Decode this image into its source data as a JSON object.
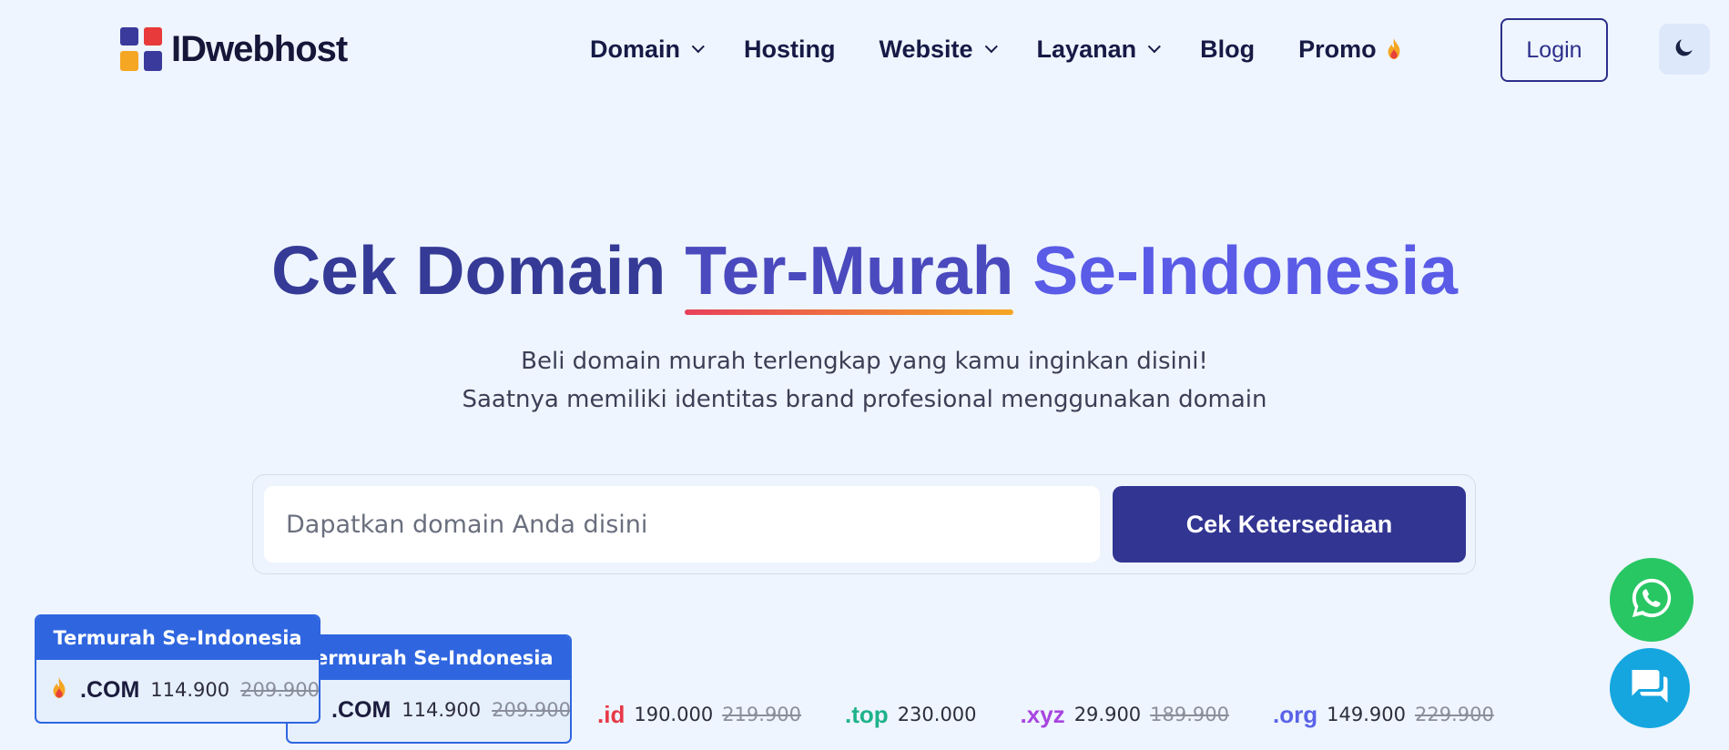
{
  "brand": {
    "name": "IDwebhost"
  },
  "nav": {
    "items": [
      {
        "label": "Domain",
        "has_dropdown": true
      },
      {
        "label": "Hosting",
        "has_dropdown": false
      },
      {
        "label": "Website",
        "has_dropdown": true
      },
      {
        "label": "Layanan",
        "has_dropdown": true
      },
      {
        "label": "Blog",
        "has_dropdown": false
      },
      {
        "label": "Promo",
        "has_dropdown": false,
        "icon": "fire-icon"
      }
    ],
    "login_label": "Login",
    "theme_icon": "moon-icon"
  },
  "hero": {
    "title_part1": "Cek Domain",
    "title_part2": "Ter-Murah",
    "title_part3": "Se-Indonesia",
    "subtitle_line1": "Beli domain murah terlengkap yang kamu inginkan disini!",
    "subtitle_line2": "Saatnya memiliki identitas brand profesional menggunakan domain"
  },
  "search": {
    "placeholder": "Dapatkan domain Anda disini",
    "value": "",
    "button_label": "Cek Ketersediaan"
  },
  "cards": [
    {
      "badge": "Termurah Se-Indonesia",
      "tld": ".COM",
      "price": "114.900",
      "old_price": "209.900"
    },
    {
      "badge": "Termurah Se-Indonesia",
      "tld": ".COM",
      "price": "114.900",
      "old_price": "209.900"
    }
  ],
  "tlds": [
    {
      "tld": ".id",
      "price": "190.000",
      "old_price": "219.900",
      "color": "#e63946"
    },
    {
      "tld": ".top",
      "price": "230.000",
      "old_price": "",
      "color": "#1fb28a"
    },
    {
      "tld": ".xyz",
      "price": "29.900",
      "old_price": "189.900",
      "color": "#a845e0"
    },
    {
      "tld": ".org",
      "price": "149.900",
      "old_price": "229.900",
      "color": "#5a63e6"
    }
  ],
  "colors": {
    "primary": "#323592",
    "card_blue": "#2f66e0",
    "whatsapp": "#28c764",
    "chat": "#15a6e0"
  }
}
